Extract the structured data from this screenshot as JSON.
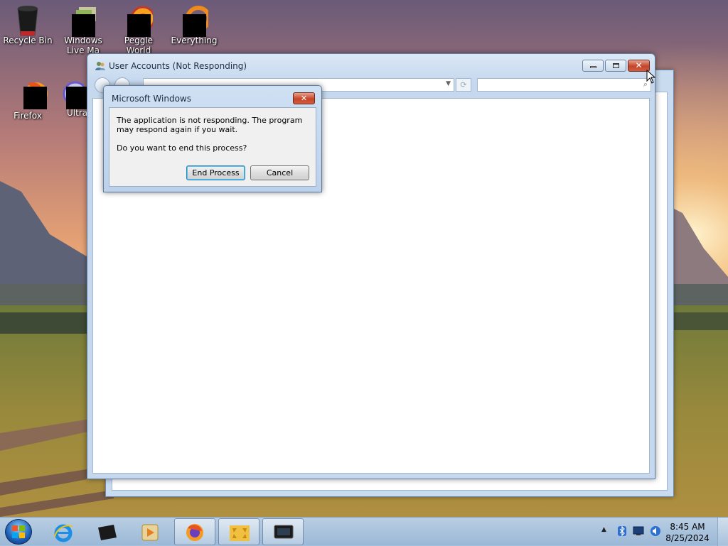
{
  "desktop": {
    "icons": [
      {
        "label": "Recycle Bin"
      },
      {
        "label": "Windows Live Ma"
      },
      {
        "label": "Peggle World"
      },
      {
        "label": "Everything"
      },
      {
        "label": "Firefox"
      },
      {
        "label": "Ultral"
      }
    ]
  },
  "main_window": {
    "title": "User Accounts (Not Responding)",
    "address_value": "",
    "search_placeholder": ""
  },
  "dialog": {
    "title": "Microsoft Windows",
    "message": "The application is not responding. The program may respond again if you wait.",
    "question": "Do you want to end this process?",
    "end_process_label": "End Process",
    "cancel_label": "Cancel"
  },
  "taskbar": {
    "pinned": [
      "start-icon",
      "internet-explorer-icon",
      "device-icon",
      "media-player-icon",
      "firefox-icon",
      "folder-arrows-icon",
      "monitor-icon"
    ],
    "clock_time": "8:45 AM",
    "clock_date": "8/25/2024",
    "tray_icons": [
      "show-hidden-icons-chevron",
      "bluetooth-icon",
      "network-icon",
      "volume-icon"
    ]
  },
  "colors": {
    "accent_close": "#c64528",
    "window_frame": "#c5d8ee",
    "taskbar": "#a8c5e3"
  }
}
